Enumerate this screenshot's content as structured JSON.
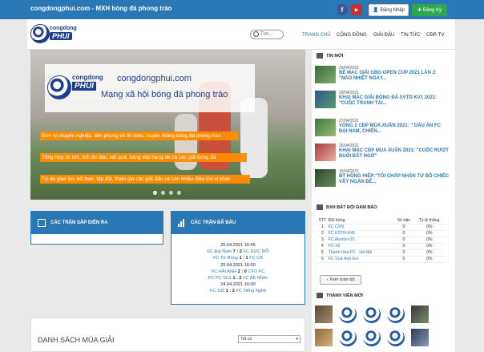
{
  "topbar": {
    "site_title": "congdongphui.com - MXH bóng đá phong trào",
    "facebook": "f",
    "youtube": "You Tube",
    "login_label": "Đăng Nhập",
    "register_label": "Đăng Ký"
  },
  "header": {
    "logo_top": "congdong",
    "logo_bottom": "PHUI",
    "search_placeholder": "Tìm...",
    "nav": [
      "TRANG CHỦ",
      "CỘNG ĐỒNG",
      "GIẢI ĐẤU",
      "TIN TỨC",
      "CĐP-TV"
    ]
  },
  "slider": {
    "logo_top": "congdong",
    "logo_bottom": "PHUI",
    "url": "congdongphui.com",
    "tagline": "Mạng xã hội bóng đá phong trào",
    "stripes": [
      "Đơn vị chuyên nghiệp, tiên phong về tổ chức, truyền thông bóng đá phong trào",
      "Tổng hợp tin tức, lịch thi đấu, kết quả, bảng xếp hạng tất cả các giải bóng đá",
      "Tự do giao lưu kết bạn, tập đội, tham gia các giải đấu và còn nhiều điều thú vị khác"
    ]
  },
  "upcoming": {
    "title": "CÁC TRẬN SẮP DIỄN RA"
  },
  "played": {
    "title": "CÁC TRẬN ĐÃ ĐẤU",
    "matches": [
      {
        "date": "25.04.2021 16:45",
        "home": "FC Đại Nam",
        "score": "7 : 2",
        "away": "FC RỰC RỠ"
      },
      {
        "date": "",
        "home": "FC Tờ Rồng",
        "score": "1 : 1",
        "away": "FC CA"
      },
      {
        "date": "25.04.2021 16:00",
        "home": "FC HẢI ANH",
        "score": "2 : 0",
        "away": "CFO FC"
      },
      {
        "date": "",
        "home": "FC PC VLS",
        "score": "1 : 2",
        "away": "FC AE Nhỏn"
      },
      {
        "date": "24.04.2021 16:00",
        "home": "FC 135",
        "score": "1 : 2",
        "away": "FC Tiếng Nghệ"
      }
    ]
  },
  "seasons": {
    "title": "DANH SÁCH MÙA GIẢI",
    "select_value": "Tất cả"
  },
  "news": {
    "title": "TIN MỚI",
    "items": [
      {
        "date": "29/04/2021",
        "title": "BẾ MẠC GIẢI GBG OPEN CUP 2021 LẦN 2: \"NÁO NHIỆT NGÀY..."
      },
      {
        "date": "29/04/2021",
        "title": "KHAI MẠC GIẢI BÓNG ĐÁ SVTD KV1 2021: \"CUỘC TRANH TÀI..."
      },
      {
        "date": "27/04/2021",
        "title": "VÒNG 2 CĐP MÙA XUÂN 2021: \" DẤU ẤN FC ĐẠI NAM, CHIẾN..."
      },
      {
        "date": "26/04/2021",
        "title": "KHAI MẠC CĐP MÙA XUÂN 2021: \"CUỘC RƯỢT ĐUỔI BẤT NGỜ\""
      },
      {
        "date": "15/04/2021",
        "title": "BT HỒNG HIỆP:\"TÔI CHẤP NHẬN TỪ BỎ CHIẾC VẬY NGÀN ĐÊ..."
      }
    ]
  },
  "ranking": {
    "title": "BXH BẤT ĐỘI ĐÁM BẢO",
    "headers": [
      "STT",
      "Đội bóng",
      "Số trận",
      "Tỷ lệ thắng"
    ],
    "rows": [
      [
        "1",
        "FC CVN",
        "0",
        "0%"
      ],
      [
        "2",
        "FC KSTN-K45",
        "0",
        "0%"
      ],
      [
        "3",
        "FC Alumni-US",
        "0",
        "0%"
      ],
      [
        "4",
        "FC-16",
        "0",
        "0%"
      ],
      [
        "5",
        "Thanh Hóa FC - Hà Nội",
        "0",
        "0%"
      ],
      [
        "6",
        "FC VL& Anh Em",
        "0",
        "0%"
      ]
    ],
    "view_all": "Xem toàn bộ"
  },
  "members": {
    "title": "THÀNH VIÊN MỚI"
  }
}
